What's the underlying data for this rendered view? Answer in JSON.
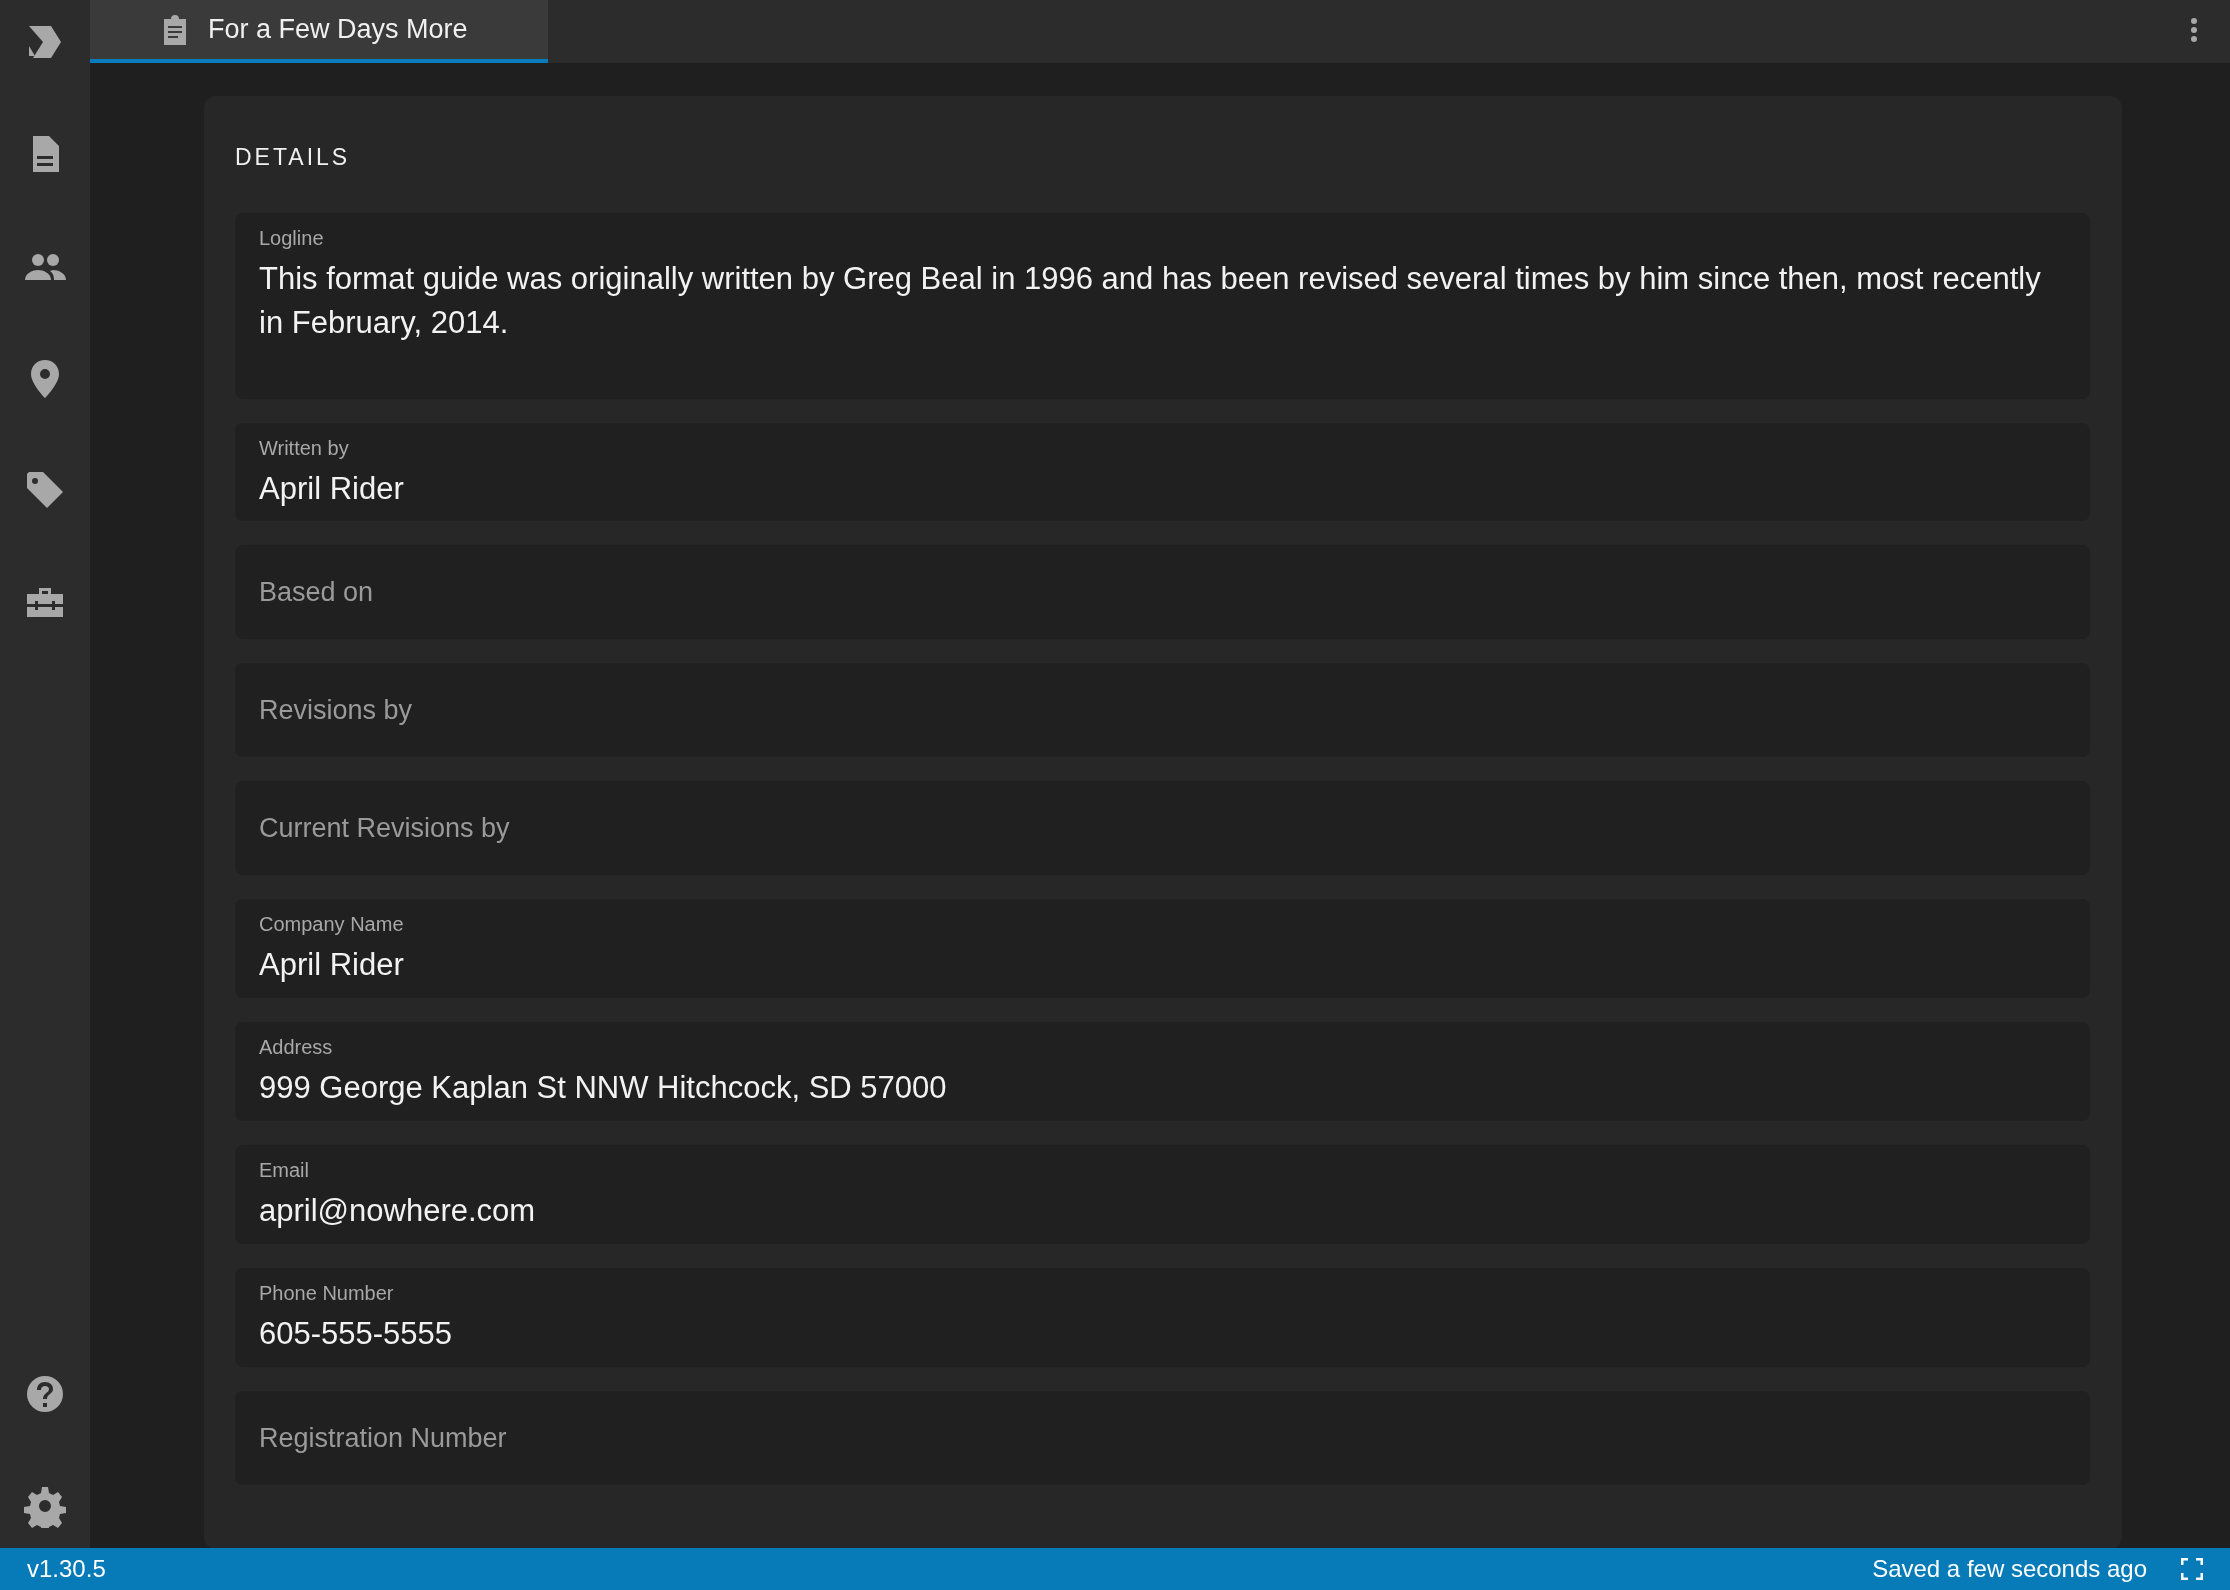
{
  "sidebar": {
    "items": [
      {
        "kind": "logo"
      },
      {
        "kind": "document"
      },
      {
        "kind": "people"
      },
      {
        "kind": "location"
      },
      {
        "kind": "tag"
      },
      {
        "kind": "toolbox"
      }
    ],
    "bottom_items": [
      {
        "kind": "help"
      },
      {
        "kind": "settings"
      }
    ]
  },
  "tabs": [
    {
      "label": "For a Few Days More",
      "selected": true
    }
  ],
  "section": {
    "title": "DETAILS"
  },
  "fields": [
    {
      "label": "Logline",
      "value": "This format guide was originally written by Greg Beal in 1996 and has been revised several times by him since then, most recently in February, 2014.",
      "kind": "multiline"
    },
    {
      "label": "Written by",
      "value": "April Rider"
    },
    {
      "placeholder": "Based on"
    },
    {
      "placeholder": "Revisions by"
    },
    {
      "placeholder": "Current Revisions by"
    },
    {
      "label": "Company Name",
      "value": "April Rider"
    },
    {
      "label": "Address",
      "value": "999 George Kaplan St NNW Hitchcock, SD 57000"
    },
    {
      "label": "Email",
      "value": "april@nowhere.com"
    },
    {
      "label": "Phone Number",
      "value": "605-555-5555"
    },
    {
      "placeholder": "Registration Number"
    }
  ],
  "status_bar": {
    "version": "v1.30.5",
    "save_status": "Saved a few seconds ago"
  }
}
